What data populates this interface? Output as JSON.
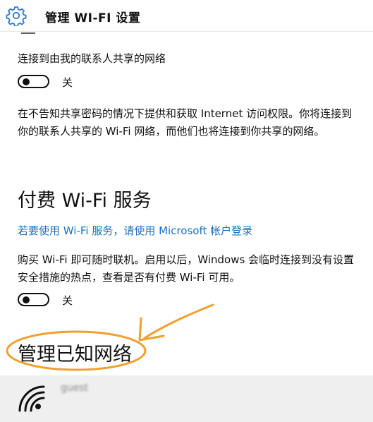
{
  "header": {
    "title": "管理 WI-FI 设置",
    "icon": "gear-icon"
  },
  "contacts_sharing": {
    "label": "连接到由我的联系人共享的网络",
    "toggle_state": "关",
    "description": "在不告知共享密码的情况下提供和获取 Internet 访问权限。你将连接到你的联系人共享的 Wi-Fi 网络，而他们也将连接到你共享的网络。"
  },
  "paid_wifi": {
    "heading": "付费 Wi-Fi 服务",
    "link": "若要使用 Wi-Fi 服务，请使用 Microsoft 帐户登录",
    "description": "购买 Wi-Fi 即可随时联机。启用以后，Windows 会临时连接到没有设置安全措施的热点，查看是否有付费 Wi-Fi 可用。",
    "toggle_state": "关"
  },
  "known_networks": {
    "heading": "管理已知网络",
    "networks": [
      {
        "name": "guest",
        "icon": "wifi-signal-icon"
      }
    ]
  },
  "annotation": {
    "color": "#f0a030"
  },
  "colors": {
    "link": "#1a6fbd",
    "annotation": "#f0a030",
    "row_bg": "#efefef"
  }
}
